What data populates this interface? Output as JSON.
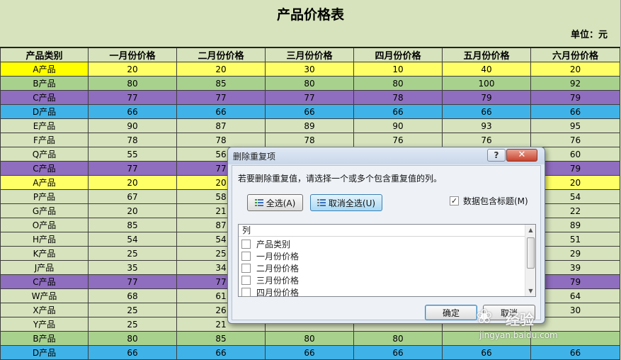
{
  "sheet": {
    "title": "产品价格表",
    "unit": "单位：元",
    "columns": [
      "产品类别",
      "一月份价格",
      "二月份价格",
      "三月份价格",
      "四月份价格",
      "五月份价格",
      "六月份价格"
    ],
    "rows": [
      {
        "cells": [
          "A产品",
          "20",
          "20",
          "30",
          "10",
          "40",
          "20"
        ],
        "color": "#ffff66",
        "name_color": "#ffff00"
      },
      {
        "cells": [
          "B产品",
          "80",
          "85",
          "80",
          "80",
          "100",
          "92"
        ],
        "color": "#a9d18e",
        "name_color": "#a9d18e"
      },
      {
        "cells": [
          "C产品",
          "77",
          "77",
          "77",
          "78",
          "79",
          "79"
        ],
        "color": "#8f6dbf",
        "name_color": "#8f6dbf"
      },
      {
        "cells": [
          "D产品",
          "66",
          "66",
          "66",
          "66",
          "66",
          "66"
        ],
        "color": "#3fb3e8",
        "name_color": "#3fb3e8"
      },
      {
        "cells": [
          "E产品",
          "90",
          "87",
          "89",
          "90",
          "93",
          "95"
        ],
        "color": "#d6e3bc",
        "name_color": "#d6e3bc"
      },
      {
        "cells": [
          "F产品",
          "78",
          "78",
          "78",
          "76",
          "76",
          "76"
        ],
        "color": "#d6e3bc",
        "name_color": "#d6e3bc"
      },
      {
        "cells": [
          "Q产品",
          "55",
          "56",
          "",
          "",
          "",
          "60"
        ],
        "color": "#d6e3bc",
        "name_color": "#d6e3bc"
      },
      {
        "cells": [
          "C产品",
          "77",
          "77",
          "",
          "",
          "",
          "79"
        ],
        "color": "#8f6dbf",
        "name_color": "#8f6dbf"
      },
      {
        "cells": [
          "A产品",
          "20",
          "20",
          "",
          "",
          "",
          "20"
        ],
        "color": "#ffff66",
        "name_color": "#ffff66"
      },
      {
        "cells": [
          "P产品",
          "67",
          "58",
          "",
          "",
          "",
          "54"
        ],
        "color": "#d6e3bc",
        "name_color": "#d6e3bc"
      },
      {
        "cells": [
          "G产品",
          "20",
          "21",
          "",
          "",
          "",
          "22"
        ],
        "color": "#d6e3bc",
        "name_color": "#d6e3bc"
      },
      {
        "cells": [
          "O产品",
          "85",
          "87",
          "",
          "",
          "",
          "89"
        ],
        "color": "#d6e3bc",
        "name_color": "#d6e3bc"
      },
      {
        "cells": [
          "H产品",
          "54",
          "54",
          "",
          "",
          "",
          "51"
        ],
        "color": "#d6e3bc",
        "name_color": "#d6e3bc"
      },
      {
        "cells": [
          "K产品",
          "25",
          "25",
          "",
          "",
          "",
          "29"
        ],
        "color": "#d6e3bc",
        "name_color": "#d6e3bc"
      },
      {
        "cells": [
          "J产品",
          "35",
          "34",
          "",
          "",
          "",
          "39"
        ],
        "color": "#d6e3bc",
        "name_color": "#d6e3bc"
      },
      {
        "cells": [
          "C产品",
          "77",
          "77",
          "",
          "",
          "",
          "79"
        ],
        "color": "#8f6dbf",
        "name_color": "#8f6dbf"
      },
      {
        "cells": [
          "W产品",
          "68",
          "61",
          "",
          "",
          "",
          "64"
        ],
        "color": "#d6e3bc",
        "name_color": "#d6e3bc"
      },
      {
        "cells": [
          "X产品",
          "25",
          "26",
          "",
          "",
          "",
          "30"
        ],
        "color": "#d6e3bc",
        "name_color": "#d6e3bc"
      },
      {
        "cells": [
          "Y产品",
          "25",
          "21",
          "",
          "",
          "",
          ""
        ],
        "color": "#d6e3bc",
        "name_color": "#d6e3bc"
      },
      {
        "cells": [
          "B产品",
          "80",
          "85",
          "80",
          "80",
          "",
          ""
        ],
        "color": "#a9d18e",
        "name_color": "#a9d18e"
      },
      {
        "cells": [
          "D产品",
          "66",
          "66",
          "66",
          "66",
          "66",
          "66"
        ],
        "color": "#3fb3e8",
        "name_color": "#3fb3e8"
      }
    ]
  },
  "dialog": {
    "title": "删除重复项",
    "help": "?",
    "close": "✕",
    "prompt": "若要删除重复值，请选择一个或多个包含重复值的列。",
    "select_all": "全选(A)",
    "unselect_all": "取消全选(U)",
    "header_checkbox_label": "数据包含标题(M)",
    "header_checkbox_checked": true,
    "list_header": "列",
    "columns_list": [
      "产品类别",
      "一月份价格",
      "二月份价格",
      "三月份价格",
      "四月份价格"
    ],
    "ok": "确定",
    "cancel": "取消"
  },
  "watermark": {
    "text": "经验",
    "url": "jingyan.baidu.com"
  }
}
